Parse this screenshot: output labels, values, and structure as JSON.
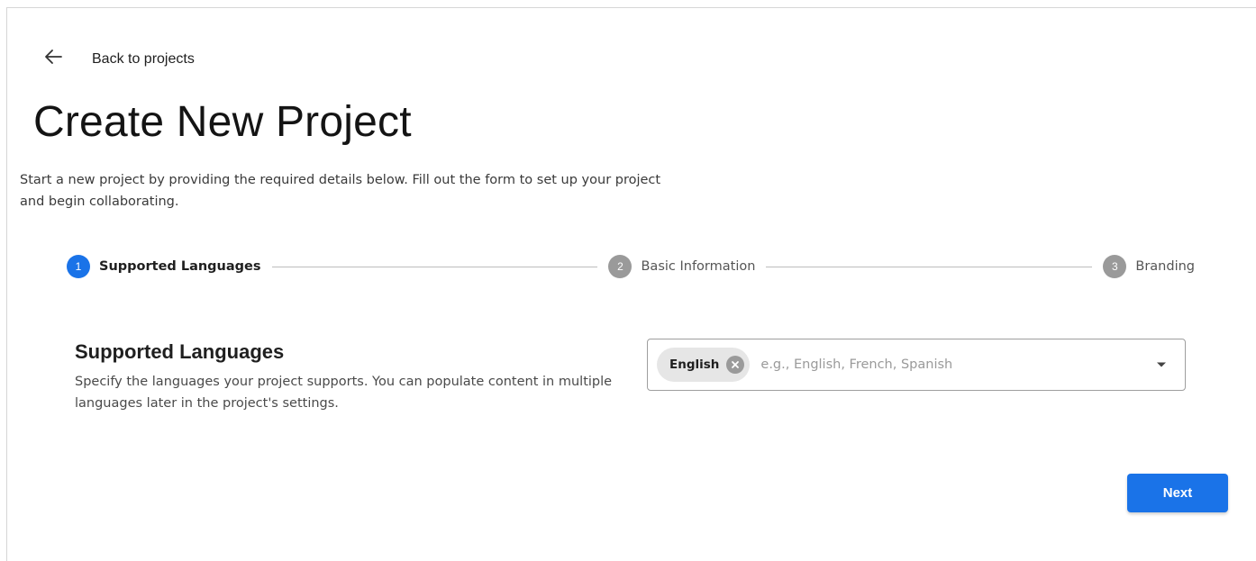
{
  "header": {
    "back_label": "Back to projects",
    "title": "Create New Project",
    "description": "Start a new project by providing the required details below. Fill out the form to set up your project and begin collaborating."
  },
  "stepper": {
    "steps": [
      {
        "number": "1",
        "label": "Supported Languages",
        "active": true
      },
      {
        "number": "2",
        "label": "Basic Information",
        "active": false
      },
      {
        "number": "3",
        "label": "Branding",
        "active": false
      }
    ]
  },
  "section": {
    "title": "Supported Languages",
    "description": "Specify the languages your project supports. You can populate content in multiple languages later in the project's settings."
  },
  "language_field": {
    "selected": [
      "English"
    ],
    "placeholder": "e.g., English, French, Spanish",
    "value": ""
  },
  "actions": {
    "next_label": "Next"
  },
  "icons": {
    "back": "arrow-left-icon",
    "chip_remove": "close-circle-icon",
    "dropdown": "caret-down-icon"
  },
  "colors": {
    "accent": "#1a73e8",
    "inactive_step": "#9a9a9a"
  }
}
